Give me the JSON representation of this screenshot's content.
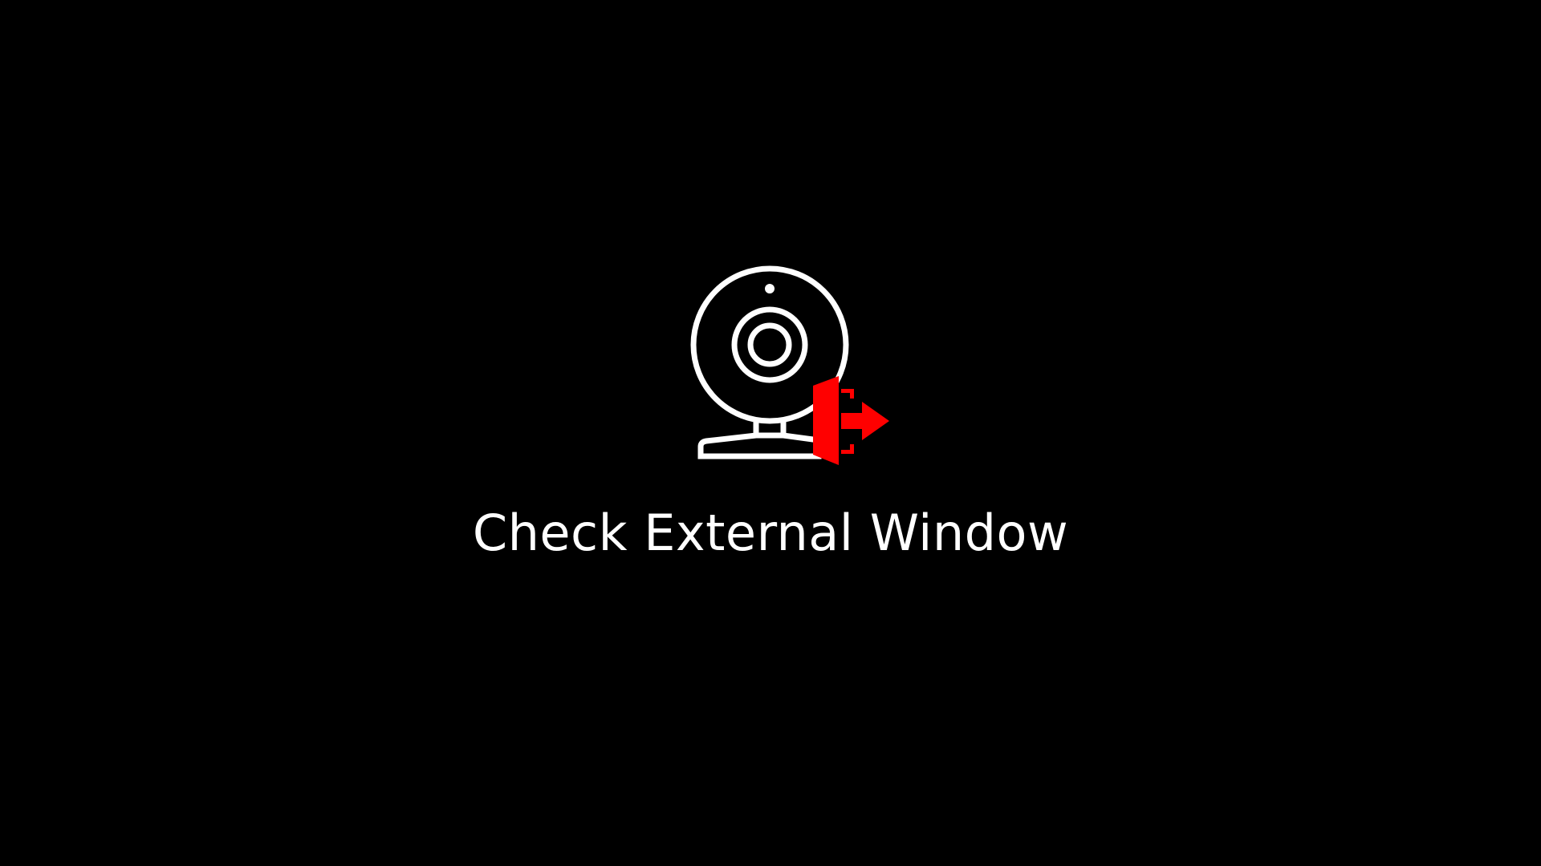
{
  "screen": {
    "message": "Check External Window"
  },
  "icon": {
    "name": "webcam-external-window-icon",
    "camera_color": "#ffffff",
    "overlay_name": "exit-arrow-icon",
    "overlay_color": "#ff0000"
  },
  "background_color": "#000000"
}
